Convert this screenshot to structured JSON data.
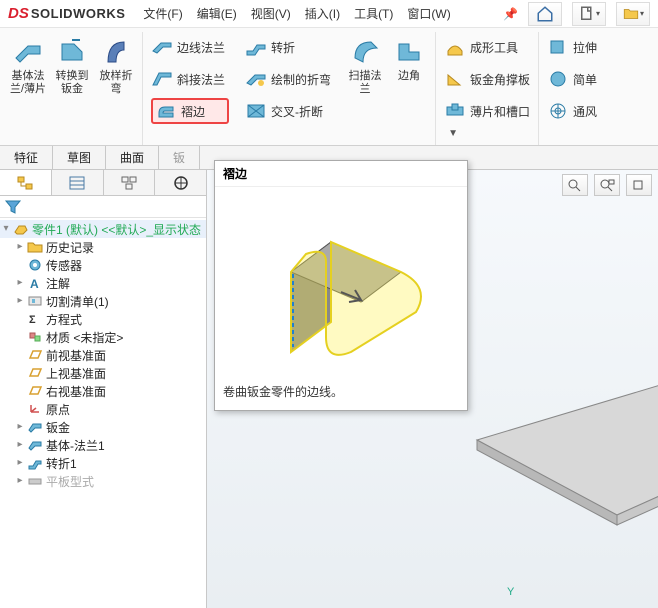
{
  "app": {
    "logo_prefix": "DS",
    "logo_name": "SOLIDWORKS"
  },
  "menus": [
    "文件(F)",
    "编辑(E)",
    "视图(V)",
    "插入(I)",
    "工具(T)",
    "窗口(W)"
  ],
  "ribbon": {
    "big": [
      {
        "label": "基体法\n兰/薄片"
      },
      {
        "label": "转换到\n钣金"
      },
      {
        "label": "放样折\n弯"
      }
    ],
    "col1": [
      "边线法兰",
      "斜接法兰",
      "褶边"
    ],
    "col2": [
      "转折",
      "绘制的折弯",
      "交叉-折断"
    ],
    "big2": [
      {
        "label": "扫描法\n兰"
      },
      {
        "label": "边角"
      }
    ],
    "col3": [
      "成形工具",
      "钣金角撑板",
      "薄片和槽口"
    ],
    "col4": [
      "拉伸",
      "简单",
      "通风"
    ]
  },
  "tabs": [
    "特征",
    "草图",
    "曲面",
    "钣"
  ],
  "tree": {
    "root": "零件1 (默认) <<默认>_显示状态",
    "items": [
      {
        "label": "历史记录",
        "exp": "▸"
      },
      {
        "label": "传感器",
        "exp": " "
      },
      {
        "label": "注解",
        "exp": "▸"
      },
      {
        "label": "切割清单(1)",
        "exp": "▸"
      },
      {
        "label": "方程式",
        "exp": " "
      },
      {
        "label": "材质 <未指定>",
        "exp": " "
      },
      {
        "label": "前视基准面",
        "exp": " "
      },
      {
        "label": "上视基准面",
        "exp": " "
      },
      {
        "label": "右视基准面",
        "exp": " "
      },
      {
        "label": "原点",
        "exp": " "
      },
      {
        "label": "钣金",
        "exp": "▸"
      },
      {
        "label": "基体-法兰1",
        "exp": "▸"
      },
      {
        "label": "转折1",
        "exp": "▸"
      },
      {
        "label": "平板型式",
        "exp": "▸",
        "dim": true
      }
    ]
  },
  "tooltip": {
    "title": "褶边",
    "desc": "卷曲钣金零件的边线。"
  },
  "axis": "Y"
}
